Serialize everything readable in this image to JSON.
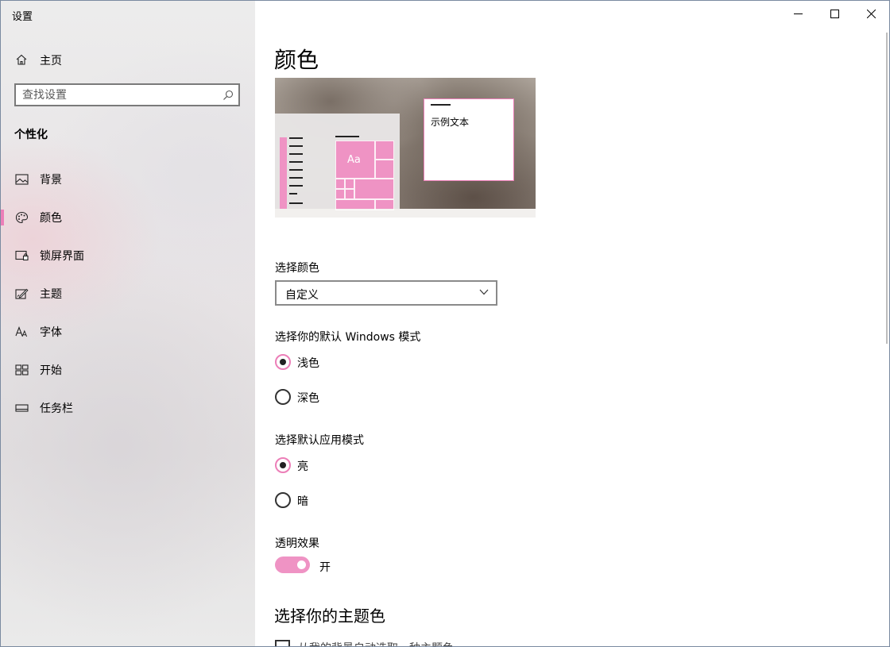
{
  "app": {
    "title": "设置"
  },
  "window_controls": {
    "minimize": "minimize-icon",
    "maximize": "maximize-icon",
    "close": "close-icon"
  },
  "sidebar": {
    "home_label": "主页",
    "search_placeholder": "查找设置",
    "section_heading": "个性化",
    "items": [
      {
        "label": "背景",
        "icon": "picture-icon"
      },
      {
        "label": "颜色",
        "icon": "palette-icon",
        "selected": true
      },
      {
        "label": "锁屏界面",
        "icon": "lock-screen-icon"
      },
      {
        "label": "主题",
        "icon": "theme-icon"
      },
      {
        "label": "字体",
        "icon": "font-icon"
      },
      {
        "label": "开始",
        "icon": "start-icon"
      },
      {
        "label": "任务栏",
        "icon": "taskbar-icon"
      }
    ]
  },
  "main": {
    "page_title": "颜色",
    "preview": {
      "tile_text": "Aa",
      "sample_text": "示例文本"
    },
    "choose_color": {
      "label": "选择颜色",
      "value": "自定义"
    },
    "windows_mode": {
      "label": "选择你的默认 Windows 模式",
      "options": [
        "浅色",
        "深色"
      ],
      "selected": "浅色"
    },
    "app_mode": {
      "label": "选择默认应用模式",
      "options": [
        "亮",
        "暗"
      ],
      "selected": "亮"
    },
    "transparency": {
      "label": "透明效果",
      "state_label": "开",
      "on": true
    },
    "accent_heading": "选择你的主题色",
    "auto_accent_checkbox": "从我的背景自动选取一种主题色"
  },
  "colors": {
    "accent": "#EC7FB8",
    "accent_tile": "#EF93C4"
  }
}
